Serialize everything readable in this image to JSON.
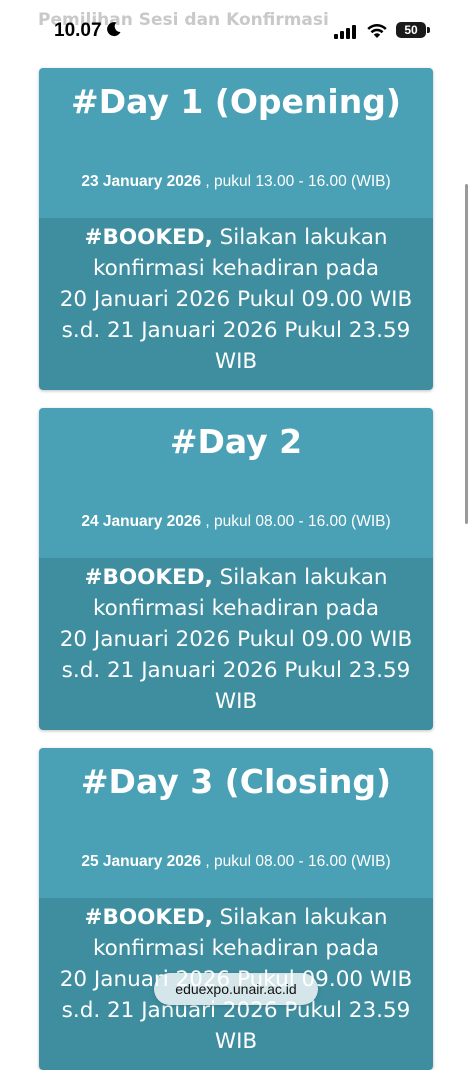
{
  "status_bar": {
    "time": "10.07",
    "battery": "50"
  },
  "page": {
    "heading": "Pemilihan Sesi dan Konfirmasi"
  },
  "sessions": [
    {
      "title": "#Day 1 (Opening)",
      "date": "23 January 2026",
      "time_text": " , pukul 13.00 - 16.00 (WIB)",
      "status": "#BOOKED,",
      "message": [
        " Silakan lakukan",
        "konfirmasi kehadiran pada",
        "20 Januari 2026 Pukul 09.00 WIB",
        "s.d. 21 Januari 2026 Pukul 23.59",
        "WIB"
      ]
    },
    {
      "title": "#Day 2",
      "date": "24 January 2026",
      "time_text": " , pukul 08.00 - 16.00 (WIB)",
      "status": "#BOOKED,",
      "message": [
        " Silakan lakukan",
        "konfirmasi kehadiran pada",
        "20 Januari 2026 Pukul 09.00 WIB",
        "s.d. 21 Januari 2026 Pukul 23.59",
        "WIB"
      ]
    },
    {
      "title": "#Day 3 (Closing)",
      "date": "25 January 2026",
      "time_text": " , pukul 08.00 - 16.00 (WIB)",
      "status": "#BOOKED,",
      "message": [
        " Silakan lakukan",
        "konfirmasi kehadiran pada",
        "20 Januari 2026 Pukul 09.00 WIB",
        "s.d. 21 Januari 2026 Pukul 23.59",
        "WIB"
      ]
    }
  ],
  "browser": {
    "url": "eduexpo.unair.ac.id"
  },
  "colors": {
    "card_header": "#4aa0b4",
    "card_body": "#3e8e9f"
  },
  "icons": [
    "moon-icon",
    "signal-icon",
    "wifi-icon",
    "battery-icon"
  ]
}
